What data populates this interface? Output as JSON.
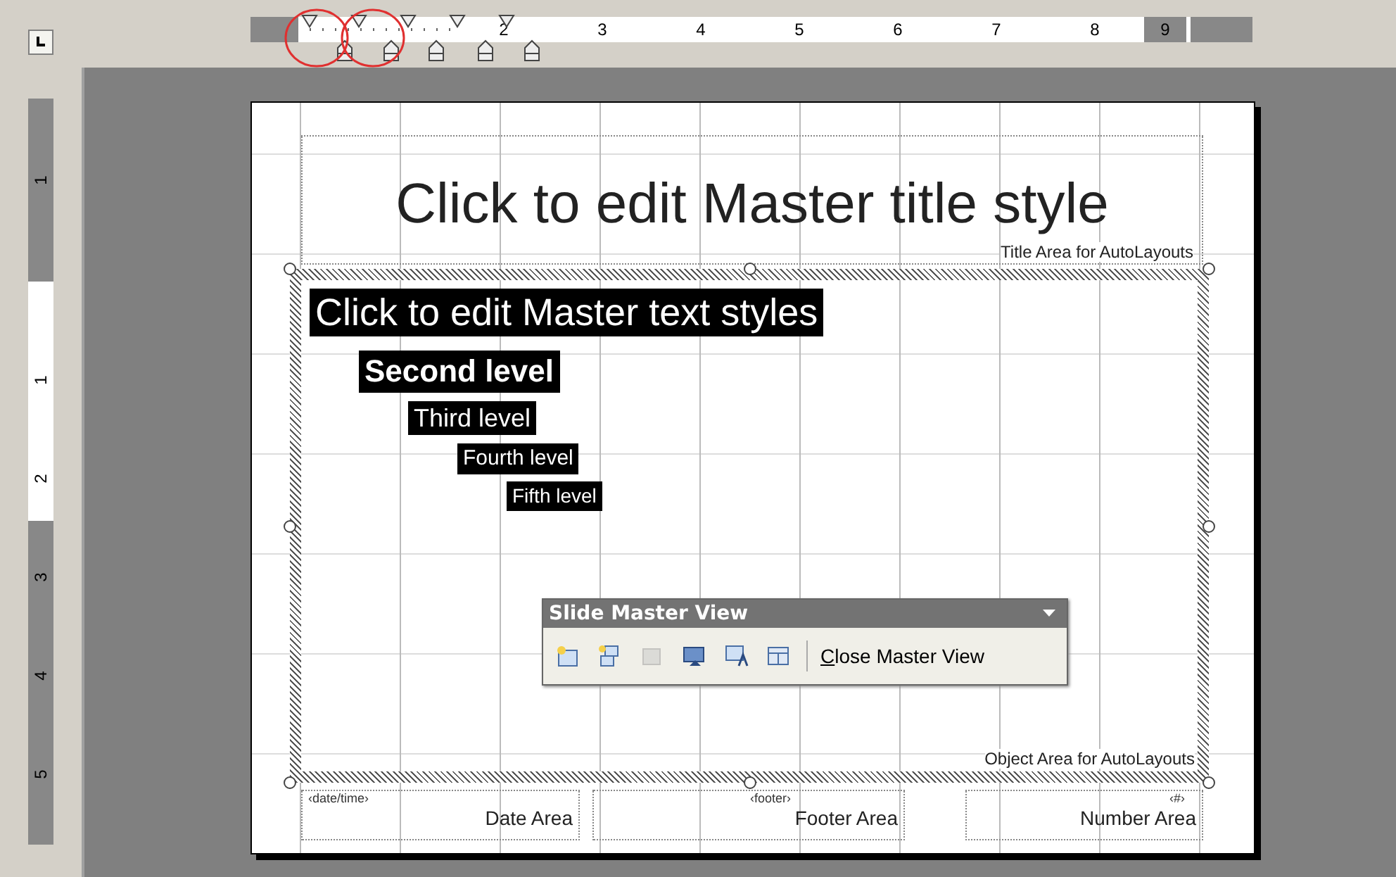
{
  "rulers": {
    "horizontal_labels": [
      "2",
      "3",
      "4",
      "5",
      "6",
      "7",
      "8",
      "9"
    ],
    "vertical_labels": [
      "1",
      "1",
      "2",
      "3",
      "4",
      "5"
    ]
  },
  "slide": {
    "title": "Click to edit Master title style",
    "title_area_label": "Title Area for AutoLayouts",
    "body_levels": [
      {
        "text": "Click to edit Master text styles",
        "selected": true
      },
      {
        "text": "Second level",
        "selected": true
      },
      {
        "text": "Third level",
        "selected": true
      },
      {
        "text": "Fourth level",
        "selected": true
      },
      {
        "text": "Fifth level",
        "selected": true
      }
    ],
    "object_area_label": "Object Area for AutoLayouts",
    "footer_placeholders": [
      {
        "tag": "‹date/time›",
        "label": "Date Area"
      },
      {
        "tag": "‹footer›",
        "label": "Footer Area"
      },
      {
        "tag": "‹#›",
        "label": "Number Area"
      }
    ]
  },
  "toolbar": {
    "title": "Slide Master View",
    "buttons": [
      {
        "kind": "insert-master",
        "disabled": false
      },
      {
        "kind": "insert-title-master",
        "disabled": false
      },
      {
        "kind": "delete-master",
        "disabled": true
      },
      {
        "kind": "preserve-master",
        "disabled": false
      },
      {
        "kind": "rename-master",
        "disabled": false
      },
      {
        "kind": "master-layout",
        "disabled": false
      }
    ],
    "close_label": "Close Master View"
  }
}
